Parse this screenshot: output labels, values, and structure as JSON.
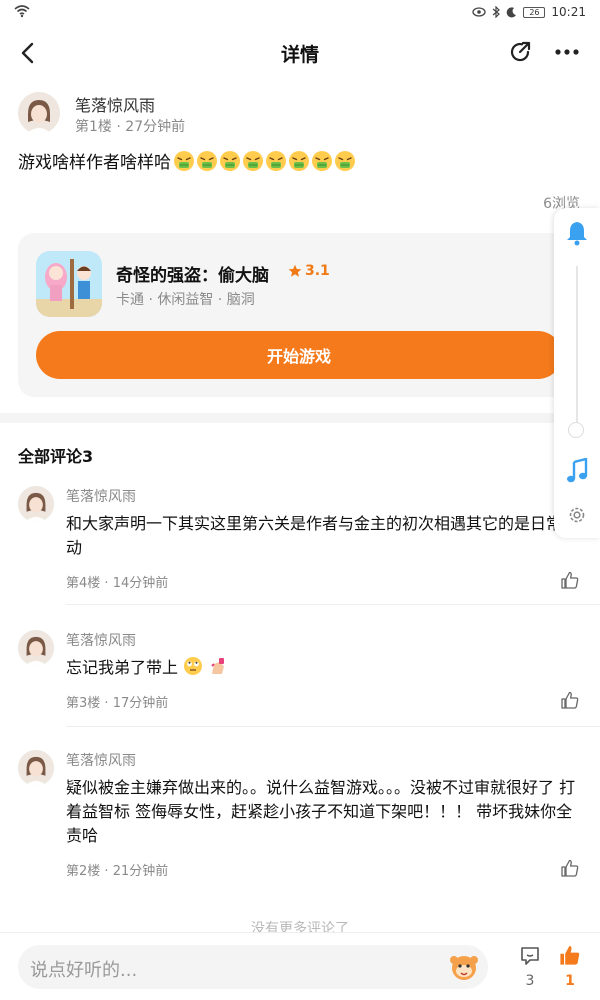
{
  "status_bar": {
    "time": "10:21",
    "battery": "26"
  },
  "header": {
    "title": "详情"
  },
  "post": {
    "author": "笔落惊风雨",
    "floor": "第1楼",
    "time_ago": "27分钟前",
    "text": "游戏啥样作者啥样哈",
    "emoji_count": 8,
    "views": "6浏览"
  },
  "game_card": {
    "name": "奇怪的强盗：偷大脑",
    "rating": "3.1",
    "tags": "卡通 · 休闲益智 · 脑洞",
    "play_button": "开始游戏"
  },
  "comments_section": {
    "title": "全部评论3",
    "items": [
      {
        "author": "笔落惊风雨",
        "text": "和大家声明一下其实这里第六关是作者与金主的初次相遇其它的是日常活动",
        "floor": "第4楼",
        "time_ago": "14分钟前"
      },
      {
        "author": "笔落惊风雨",
        "text": "忘记我弟了带上",
        "floor": "第3楼",
        "time_ago": "17分钟前"
      },
      {
        "author": "笔落惊风雨",
        "text": "疑似被金主嫌弃做出来的。。说什么益智游戏。。。没被不过审就很好了 打着益智标 签侮辱女性，赶紧趁小孩子不知道下架吧！！！ 带坏我妹你全责哈",
        "floor": "第2楼",
        "time_ago": "21分钟前"
      }
    ],
    "no_more": "没有更多评论了"
  },
  "bottom_bar": {
    "input_placeholder": "说点好听的...",
    "comment_count": "3",
    "like_count": "1"
  },
  "colors": {
    "accent": "#f47a1b",
    "rail_icon": "#3aa0f0"
  },
  "icons": [
    "wifi-icon",
    "eye-icon",
    "bluetooth-icon",
    "moon-icon",
    "back-arrow-icon",
    "share-icon",
    "more-icon",
    "bell-icon",
    "music-icon",
    "gear-icon",
    "star-icon",
    "like-icon",
    "comment-icon",
    "mascot-icon"
  ]
}
